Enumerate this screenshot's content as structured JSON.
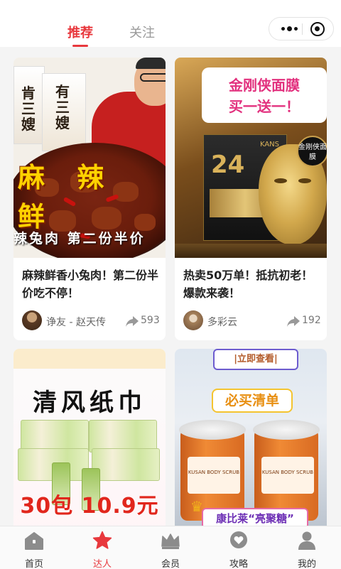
{
  "header": {
    "tabs": [
      {
        "label": "推荐",
        "active": true
      },
      {
        "label": "关注",
        "active": false
      }
    ],
    "accent_color": "#e8383d"
  },
  "capsule": {
    "more_icon": "more-dots-icon",
    "close_icon": "target-icon"
  },
  "feed": [
    {
      "image_texts": {
        "packs": [
          "有三嫂",
          "肯三嫂"
        ],
        "headline": "麻 辣 鲜",
        "banner": "辣兔肉 第二份半价"
      },
      "title": "麻辣鲜香小兔肉！第二份半价吃不停！",
      "author": "诤友 - 赵天传",
      "shares": "593"
    },
    {
      "image_texts": {
        "brand": "KANS 韩束",
        "bubble": [
          "金刚侠面膜",
          "买一送一！"
        ],
        "box_num": "24",
        "box_brand": "KANS",
        "badge": "金刚侠面膜"
      },
      "title": "热卖50万单！抵抗初老！爆款来袭！",
      "author": "多彩云",
      "shares": "192"
    },
    {
      "image_texts": {
        "headline": "清风纸巾",
        "price": "30包 10.9元"
      },
      "title": "",
      "author": "",
      "shares": ""
    },
    {
      "image_texts": {
        "promo": "|立即查看|",
        "sign": "必买清单",
        "jar_label": "KUSAN BODY SCRUB",
        "bottom": "康比莱“亮聚糖”"
      },
      "title": "",
      "author": "",
      "shares": ""
    }
  ],
  "tabbar": [
    {
      "label": "首页",
      "icon": "home-icon",
      "active": false
    },
    {
      "label": "达人",
      "icon": "star-icon",
      "active": true
    },
    {
      "label": "会员",
      "icon": "crown-icon",
      "active": false
    },
    {
      "label": "攻略",
      "icon": "heart-badge-icon",
      "active": false
    },
    {
      "label": "我的",
      "icon": "person-icon",
      "active": false
    }
  ]
}
